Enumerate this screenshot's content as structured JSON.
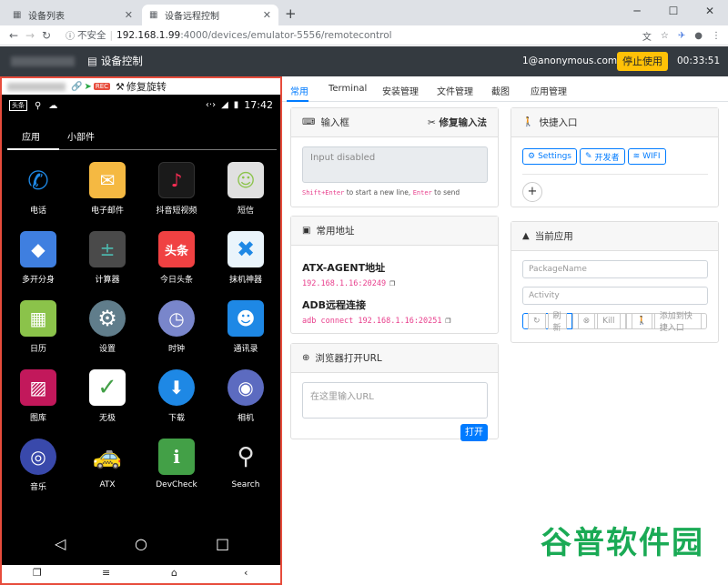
{
  "browser": {
    "tabs": [
      {
        "title": "设备列表",
        "active": false
      },
      {
        "title": "设备远程控制",
        "active": true
      }
    ],
    "window_controls": {
      "minimize": "─",
      "maximize": "☐",
      "close": "✕"
    },
    "security_label": "不安全",
    "url_host": "192.168.1.99",
    "url_path": ":4000/devices/emulator-5556/remotecontrol"
  },
  "appbar": {
    "brand": "设备控制",
    "user": "1@anonymous.com ▾",
    "stop_label": "停止使用",
    "timer": "00:33:51"
  },
  "device": {
    "toolbar_label": "修复旋转",
    "status_time": "17:42",
    "status_badge": "头条",
    "tabs": [
      "应用",
      "小部件"
    ],
    "apps": [
      {
        "label": "电话",
        "icon": "phone-icon",
        "color": "#1e88e5"
      },
      {
        "label": "电子邮件",
        "icon": "email-icon",
        "color": "#f5b942"
      },
      {
        "label": "抖音短视频",
        "icon": "douyin-icon",
        "color": "#111111"
      },
      {
        "label": "短信",
        "icon": "sms-icon",
        "color": "#e0e0e0"
      },
      {
        "label": "多开分身",
        "icon": "multi-icon",
        "color": "#3f7fe0"
      },
      {
        "label": "计算器",
        "icon": "calculator-icon",
        "color": "#4a4a4a"
      },
      {
        "label": "今日头条",
        "icon": "toutiao-icon",
        "color": "#f0f0f0"
      },
      {
        "label": "抹机神器",
        "icon": "wipe-icon",
        "color": "#eaf4fb"
      },
      {
        "label": "日历",
        "icon": "calendar-icon",
        "color": "#8bc34a"
      },
      {
        "label": "设置",
        "icon": "settings-icon",
        "color": "#607d8b"
      },
      {
        "label": "时钟",
        "icon": "clock-icon",
        "color": "#7986cb"
      },
      {
        "label": "通讯录",
        "icon": "contacts-icon",
        "color": "#1e88e5"
      },
      {
        "label": "图库",
        "icon": "gallery-icon",
        "color": "#c2185b"
      },
      {
        "label": "无极",
        "icon": "wuji-icon",
        "color": "#ffffff"
      },
      {
        "label": "下载",
        "icon": "download-icon",
        "color": "#1e88e5"
      },
      {
        "label": "相机",
        "icon": "camera-icon",
        "color": "#5c6bc0"
      },
      {
        "label": "音乐",
        "icon": "music-icon",
        "color": "#3949ab"
      },
      {
        "label": "ATX",
        "icon": "atx-icon",
        "color": "#000000"
      },
      {
        "label": "DevCheck",
        "icon": "devcheck-icon",
        "color": "#43a047"
      },
      {
        "label": "Search",
        "icon": "search-icon",
        "color": "#000000"
      }
    ],
    "nav": {
      "back": "◁",
      "home": "○",
      "recents": "□"
    },
    "bottom": {
      "copy": "❐",
      "menu": "≡",
      "home": "⌂",
      "back": "‹"
    }
  },
  "tabs": [
    "常用",
    "Terminal",
    "安装管理",
    "文件管理",
    "截图",
    "应用管理"
  ],
  "input_card": {
    "title": "输入框",
    "fix_label": "修复输入法",
    "placeholder": "Input disabled",
    "hint_key1": "Shift+Enter",
    "hint_mid": " to start a new line, ",
    "hint_key2": "Enter",
    "hint_end": " to send"
  },
  "address_card": {
    "title": "常用地址",
    "atx_label": "ATX-AGENT地址",
    "atx_value": "192.168.1.16:20249",
    "adb_label": "ADB远程连接",
    "adb_value": "adb connect 192.168.1.16:20251"
  },
  "url_card": {
    "title": "浏览器打开URL",
    "placeholder": "在这里输入URL",
    "open_label": "打开"
  },
  "quick_card": {
    "title": "快捷入口",
    "buttons": [
      "Settings",
      "开发者",
      "WIFI"
    ],
    "add": "+"
  },
  "current_app_card": {
    "title": "当前应用",
    "package_placeholder": "PackageName",
    "activity_placeholder": "Activity",
    "refresh": "刷新",
    "kill": "Kill",
    "add_shortcut": "添加到快捷入口"
  },
  "watermark": "谷普软件园"
}
